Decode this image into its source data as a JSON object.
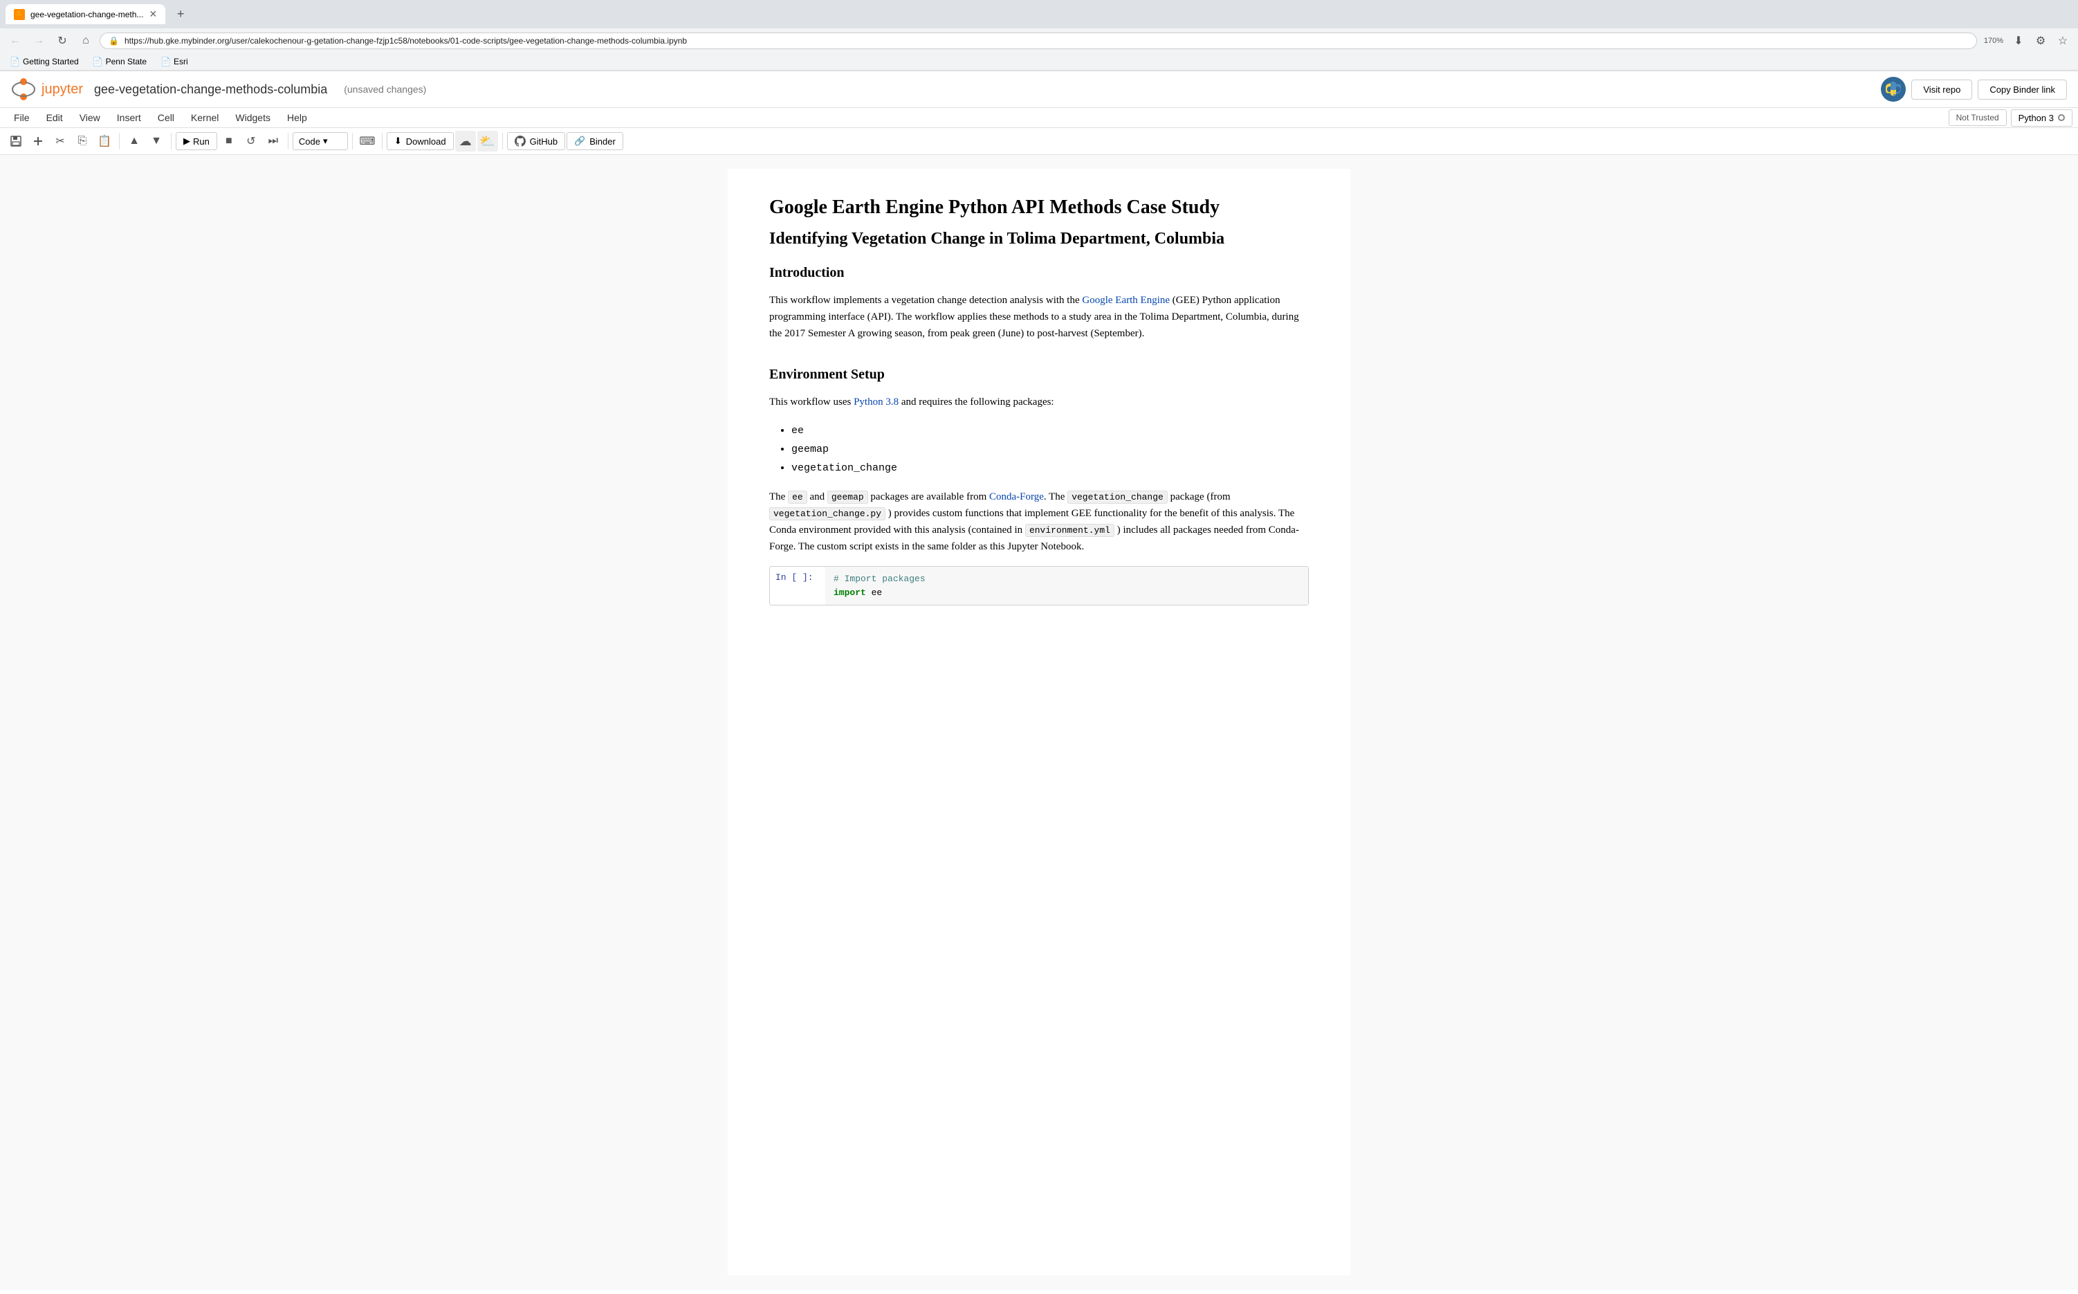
{
  "browser": {
    "tab_title": "gee-vegetation-change-meth...",
    "url": "https://hub.gke.mybinder.org/user/calekochenour-g-getation-change-fzjp1c58/notebooks/01-code-scripts/gee-vegetation-change-methods-columbia.ipynb",
    "zoom": "170%",
    "bookmarks": [
      "Getting Started",
      "Penn State",
      "Esri"
    ]
  },
  "jupyter": {
    "notebook_name": "gee-vegetation-change-methods-columbia",
    "unsaved_label": "(unsaved changes)",
    "visit_repo_label": "Visit repo",
    "copy_binder_label": "Copy Binder link",
    "not_trusted_label": "Not Trusted",
    "kernel_label": "Python 3"
  },
  "menu": {
    "items": [
      "File",
      "Edit",
      "View",
      "Insert",
      "Cell",
      "Kernel",
      "Widgets",
      "Help"
    ]
  },
  "toolbar": {
    "run_label": "Run",
    "cell_type": "Code",
    "download_label": "Download",
    "github_label": "GitHub",
    "binder_label": "Binder"
  },
  "content": {
    "title": "Google Earth Engine Python API Methods Case Study",
    "subtitle": "Identifying Vegetation Change in Tolima Department, Columbia",
    "intro_heading": "Introduction",
    "intro_para1": "This workflow implements a vegetation change detection analysis with the Google Earth Engine (GEE) Python application programming interface (API). The workflow applies these methods to a study area in the Tolima Department, Columbia, during the 2017 Semester A growing season, from peak green (June) to post-harvest (September).",
    "gee_link_text": "Google Earth Engine",
    "env_heading": "Environment Setup",
    "env_para1": "This workflow uses Python 3.8 and requires the following packages:",
    "python_link_text": "Python 3.8",
    "packages": [
      "ee",
      "geemap",
      "vegetation_change"
    ],
    "env_para2_prefix": "The ",
    "env_para2_suffix": " packages are available from Conda-Forge. The vegetation_change package (from vegetation_change.py ) provides custom functions that implement GEE functionality for the benefit of this analysis. The Conda environment provided with this analysis (contained in environment.yml ) includes all packages needed from Conda-Forge. The custom script exists in the same folder as this Jupyter Notebook.",
    "conda_forge_link": "Conda-Forge",
    "code_cell_prompt": "In [ ]:",
    "code_line1": "# Import packages",
    "code_line2_keyword": "import",
    "code_line2_text": " ee"
  }
}
